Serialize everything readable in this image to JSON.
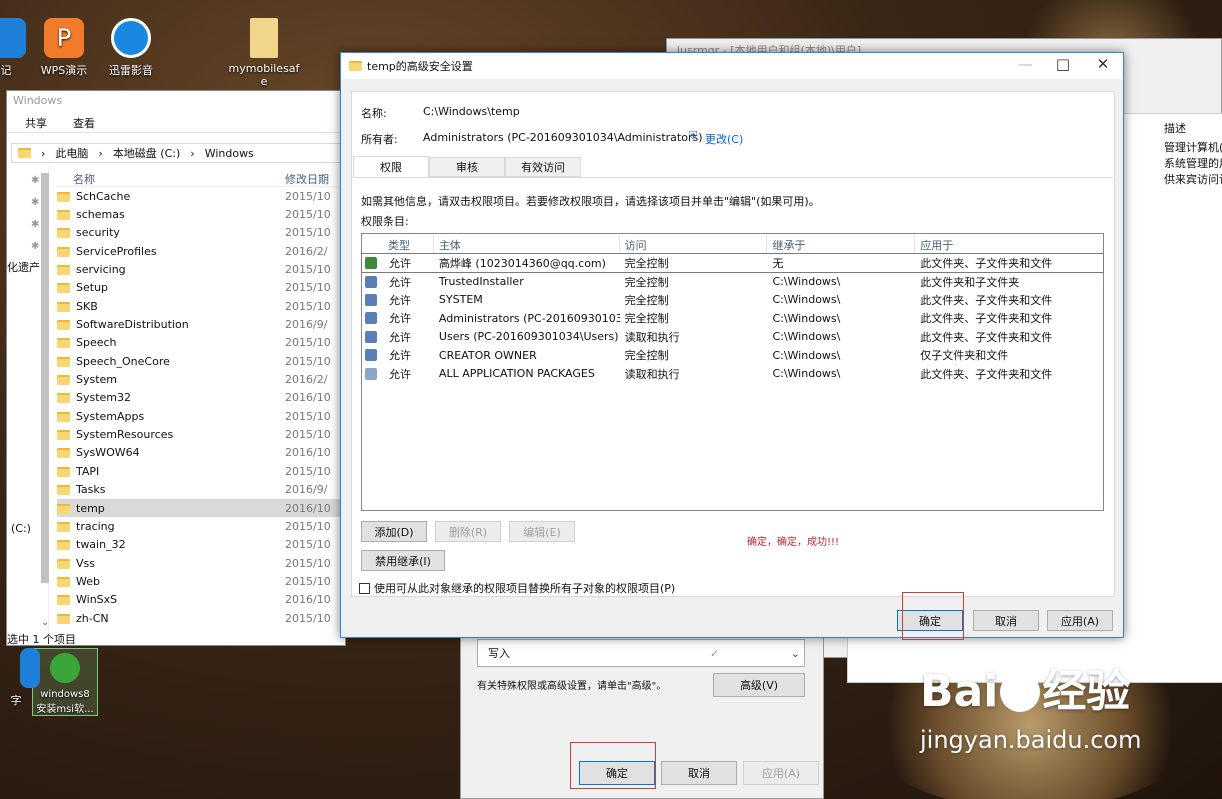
{
  "desktop": {
    "icons": [
      {
        "label": "记",
        "color": "#1e7fd8"
      },
      {
        "label": "WPS演示",
        "color": "#f07b2a"
      },
      {
        "label": "迅雷影音",
        "color": "#1a88e0"
      },
      {
        "label": "mymobilesafe",
        "color": "#f1d58a"
      }
    ],
    "bottom_icons": [
      {
        "label": "windows8\n安装msi软..."
      },
      {
        "label": "字"
      }
    ]
  },
  "explorer": {
    "title": "Windows",
    "ribbon": [
      "共享",
      "查看"
    ],
    "breadcrumb": [
      "此电脑",
      "本地磁盘 (C:)",
      "Windows"
    ],
    "columns": {
      "name": "名称",
      "date": "修改日期"
    },
    "nav_label": "化遗产",
    "drive_label": "(C:)",
    "folders": [
      {
        "name": "SchCache",
        "date": "2015/10"
      },
      {
        "name": "schemas",
        "date": "2015/10"
      },
      {
        "name": "security",
        "date": "2015/10"
      },
      {
        "name": "ServiceProfiles",
        "date": "2016/2/"
      },
      {
        "name": "servicing",
        "date": "2015/10"
      },
      {
        "name": "Setup",
        "date": "2015/10"
      },
      {
        "name": "SKB",
        "date": "2015/10"
      },
      {
        "name": "SoftwareDistribution",
        "date": "2016/9/"
      },
      {
        "name": "Speech",
        "date": "2015/10"
      },
      {
        "name": "Speech_OneCore",
        "date": "2015/10"
      },
      {
        "name": "System",
        "date": "2016/2/"
      },
      {
        "name": "System32",
        "date": "2016/10"
      },
      {
        "name": "SystemApps",
        "date": "2015/10"
      },
      {
        "name": "SystemResources",
        "date": "2015/10"
      },
      {
        "name": "SysWOW64",
        "date": "2016/10"
      },
      {
        "name": "TAPI",
        "date": "2015/10"
      },
      {
        "name": "Tasks",
        "date": "2016/9/"
      },
      {
        "name": "temp",
        "date": "2016/10"
      },
      {
        "name": "tracing",
        "date": "2015/10"
      },
      {
        "name": "twain_32",
        "date": "2015/10"
      },
      {
        "name": "Vss",
        "date": "2015/10"
      },
      {
        "name": "Web",
        "date": "2015/10"
      },
      {
        "name": "WinSxS",
        "date": "2016/10"
      },
      {
        "name": "zh-CN",
        "date": "2015/10"
      }
    ],
    "status": "选中 1 个项目"
  },
  "bgwin": {
    "title": "lusrmgr - [本地用户和组(本地)\\用户]",
    "col": "描述",
    "rows": [
      "管理计算机(",
      "系统管理的用",
      "供来宾访问计"
    ]
  },
  "subdialog": {
    "select_value": "写入",
    "hint": "有关特殊权限或高级设置，请单击\"高级\"。",
    "advanced": "高级(V)",
    "ok": "确定",
    "cancel": "取消",
    "apply": "应用(A)"
  },
  "dialog": {
    "title": "temp的高级安全设置",
    "name_label": "名称:",
    "name_value": "C:\\Windows\\temp",
    "owner_label": "所有者:",
    "owner_value": "Administrators (PC-201609301034\\Administrators)",
    "change": "更改(C)",
    "tabs": [
      "权限",
      "审核",
      "有效访问"
    ],
    "info": "如需其他信息，请双击权限项目。若要修改权限项目，请选择该项目并单击\"编辑\"(如果可用)。",
    "entries_label": "权限条目:",
    "columns": [
      "类型",
      "主体",
      "访问",
      "继承于",
      "应用于"
    ],
    "rows": [
      {
        "type": "允许",
        "principal": "高烨峰 (1023014360@qq.com)",
        "access": "完全控制",
        "inherit": "无",
        "apply": "此文件夹、子文件夹和文件"
      },
      {
        "type": "允许",
        "principal": "TrustedInstaller",
        "access": "完全控制",
        "inherit": "C:\\Windows\\",
        "apply": "此文件夹和子文件夹"
      },
      {
        "type": "允许",
        "principal": "SYSTEM",
        "access": "完全控制",
        "inherit": "C:\\Windows\\",
        "apply": "此文件夹、子文件夹和文件"
      },
      {
        "type": "允许",
        "principal": "Administrators (PC-20160930103...",
        "access": "完全控制",
        "inherit": "C:\\Windows\\",
        "apply": "此文件夹、子文件夹和文件"
      },
      {
        "type": "允许",
        "principal": "Users (PC-201609301034\\Users)",
        "access": "读取和执行",
        "inherit": "C:\\Windows\\",
        "apply": "此文件夹、子文件夹和文件"
      },
      {
        "type": "允许",
        "principal": "CREATOR OWNER",
        "access": "完全控制",
        "inherit": "C:\\Windows\\",
        "apply": "仅子文件夹和文件"
      },
      {
        "type": "允许",
        "principal": "ALL APPLICATION PACKAGES",
        "access": "读取和执行",
        "inherit": "C:\\Windows\\",
        "apply": "此文件夹、子文件夹和文件"
      }
    ],
    "add": "添加(D)",
    "remove": "删除(R)",
    "edit": "编辑(E)",
    "annotation": "确定，确定，成功!!!",
    "disable_inherit": "禁用继承(I)",
    "replace_checkbox": "使用可从此对象继承的权限项目替换所有子对象的权限项目(P)",
    "ok": "确定",
    "cancel": "取消",
    "apply": "应用(A)"
  },
  "watermark": {
    "brand": "Bai",
    "brand2": "经验",
    "url": "jingyan.baidu.com"
  }
}
